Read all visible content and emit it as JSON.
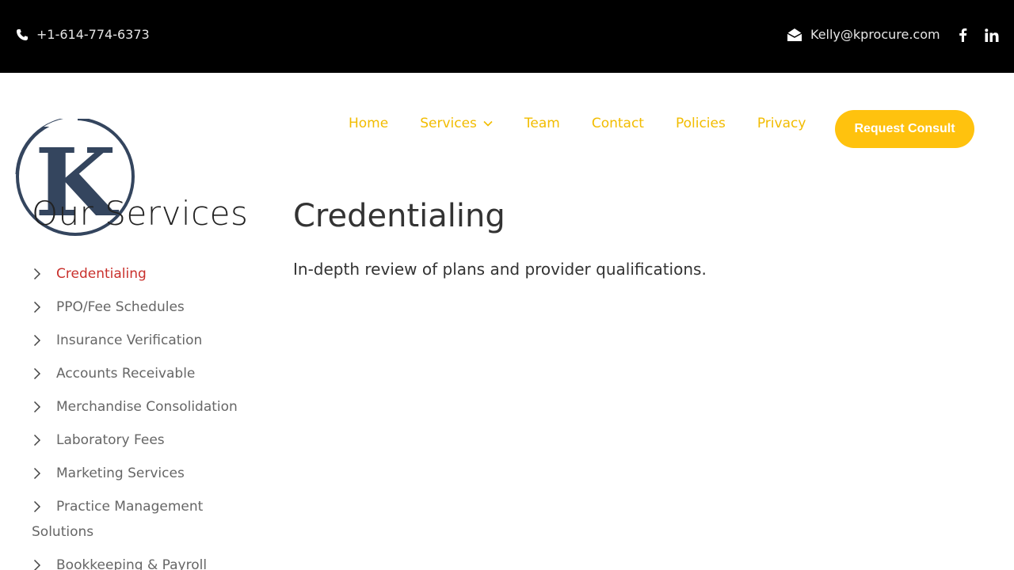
{
  "topbar": {
    "phone": "+1-614-774-6373",
    "email": "Kelly@kprocure.com",
    "icons": [
      "phone-icon",
      "envelope-icon",
      "facebook-icon",
      "linkedin-icon"
    ]
  },
  "nav": {
    "items": [
      {
        "label": "Home"
      },
      {
        "label": "Services",
        "has_dropdown": true
      },
      {
        "label": "Team"
      },
      {
        "label": "Contact"
      },
      {
        "label": "Policies"
      },
      {
        "label": "Privacy"
      }
    ],
    "cta_label": "Request Consult"
  },
  "logo": {
    "letter": "K"
  },
  "sidebar": {
    "title": "Our Services",
    "items": [
      {
        "label": "Credentialing",
        "active": true
      },
      {
        "label": "PPO/Fee Schedules"
      },
      {
        "label": "Insurance Verification"
      },
      {
        "label": "Accounts Receivable"
      },
      {
        "label": "Merchandise Consolidation"
      },
      {
        "label": "Laboratory Fees"
      },
      {
        "label": "Marketing Services"
      },
      {
        "label": "Practice Management Solutions"
      },
      {
        "label": "Bookkeeping & Payroll"
      }
    ]
  },
  "main": {
    "title": "Credentialing",
    "description": "In-depth review of plans and provider qualifications."
  },
  "colors": {
    "topbar_bg": "#000000",
    "accent": "#f2bc00",
    "cta_bg": "#ffc20e",
    "active_link": "#c9302c",
    "logo_navy": "#34455e"
  }
}
